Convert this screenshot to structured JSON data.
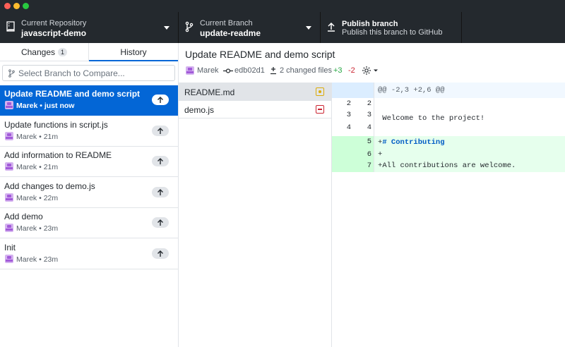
{
  "toolbar": {
    "repo": {
      "label": "Current Repository",
      "value": "javascript-demo"
    },
    "branch": {
      "label": "Current Branch",
      "value": "update-readme"
    },
    "publish": {
      "label": "Publish branch",
      "description": "Publish this branch to GitHub"
    }
  },
  "sidebar": {
    "tabs": [
      {
        "label": "Changes",
        "count": "1"
      },
      {
        "label": "History"
      }
    ],
    "branch_compare_placeholder": "Select Branch to Compare...",
    "commits": [
      {
        "title": "Update README and demo script",
        "author": "Marek",
        "time": "just now",
        "selected": true
      },
      {
        "title": "Update functions in script.js",
        "author": "Marek",
        "time": "21m"
      },
      {
        "title": "Add information to README",
        "author": "Marek",
        "time": "21m"
      },
      {
        "title": "Add changes to demo.js",
        "author": "Marek",
        "time": "22m"
      },
      {
        "title": "Add demo",
        "author": "Marek",
        "time": "23m"
      },
      {
        "title": "Init",
        "author": "Marek",
        "time": "23m"
      }
    ]
  },
  "commit_detail": {
    "title": "Update README and demo script",
    "author": "Marek",
    "sha": "edb02d1",
    "changed_files": "2 changed files",
    "additions": "+3",
    "deletions": "-2"
  },
  "files": [
    {
      "name": "README.md",
      "status": "modified"
    },
    {
      "name": "demo.js",
      "status": "deleted"
    }
  ],
  "diff": {
    "hunk_header": "@@ -2,3 +2,6 @@",
    "lines": [
      {
        "old": "2",
        "new": "2",
        "text": ""
      },
      {
        "old": "3",
        "new": "3",
        "text": " Welcome to the project!"
      },
      {
        "old": "4",
        "new": "4",
        "text": ""
      },
      {
        "old": "",
        "new": "5",
        "prefix": "+",
        "text": "# Contributing"
      },
      {
        "old": "",
        "new": "6",
        "prefix": "+",
        "text": ""
      },
      {
        "old": "",
        "new": "7",
        "prefix": "+",
        "text": "All contributions are welcome."
      }
    ]
  },
  "colors": {
    "toolbar_bg": "#24292e",
    "selection_blue": "#0366d6",
    "added_green": "#28a745",
    "deleted_red": "#cb2431"
  }
}
